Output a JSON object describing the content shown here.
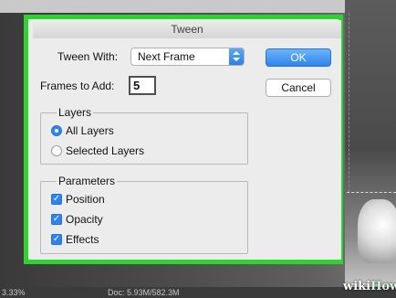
{
  "dialog": {
    "title": "Tween"
  },
  "tween_with": {
    "label": "Tween With:",
    "selected": "Next Frame"
  },
  "frames_to_add": {
    "label": "Frames to Add:",
    "value": "5"
  },
  "buttons": {
    "ok": "OK",
    "cancel": "Cancel"
  },
  "layers": {
    "title": "Layers",
    "options": [
      {
        "label": "All Layers",
        "selected": true
      },
      {
        "label": "Selected Layers",
        "selected": false
      }
    ]
  },
  "parameters": {
    "title": "Parameters",
    "items": [
      {
        "label": "Position",
        "checked": true
      },
      {
        "label": "Opacity",
        "checked": true
      },
      {
        "label": "Effects",
        "checked": true
      }
    ]
  },
  "statusbar": {
    "zoom": "3.33%",
    "doc": "Doc: 5.93M/582.3M"
  },
  "watermark": {
    "prefix": "wiki",
    "suffix": "How"
  },
  "colors": {
    "highlight_frame": "#2fd32f",
    "accent": "#2f83ec"
  },
  "icons": {
    "select_arrows": "updown-arrows-icon",
    "checkmark": "checkmark-icon"
  }
}
